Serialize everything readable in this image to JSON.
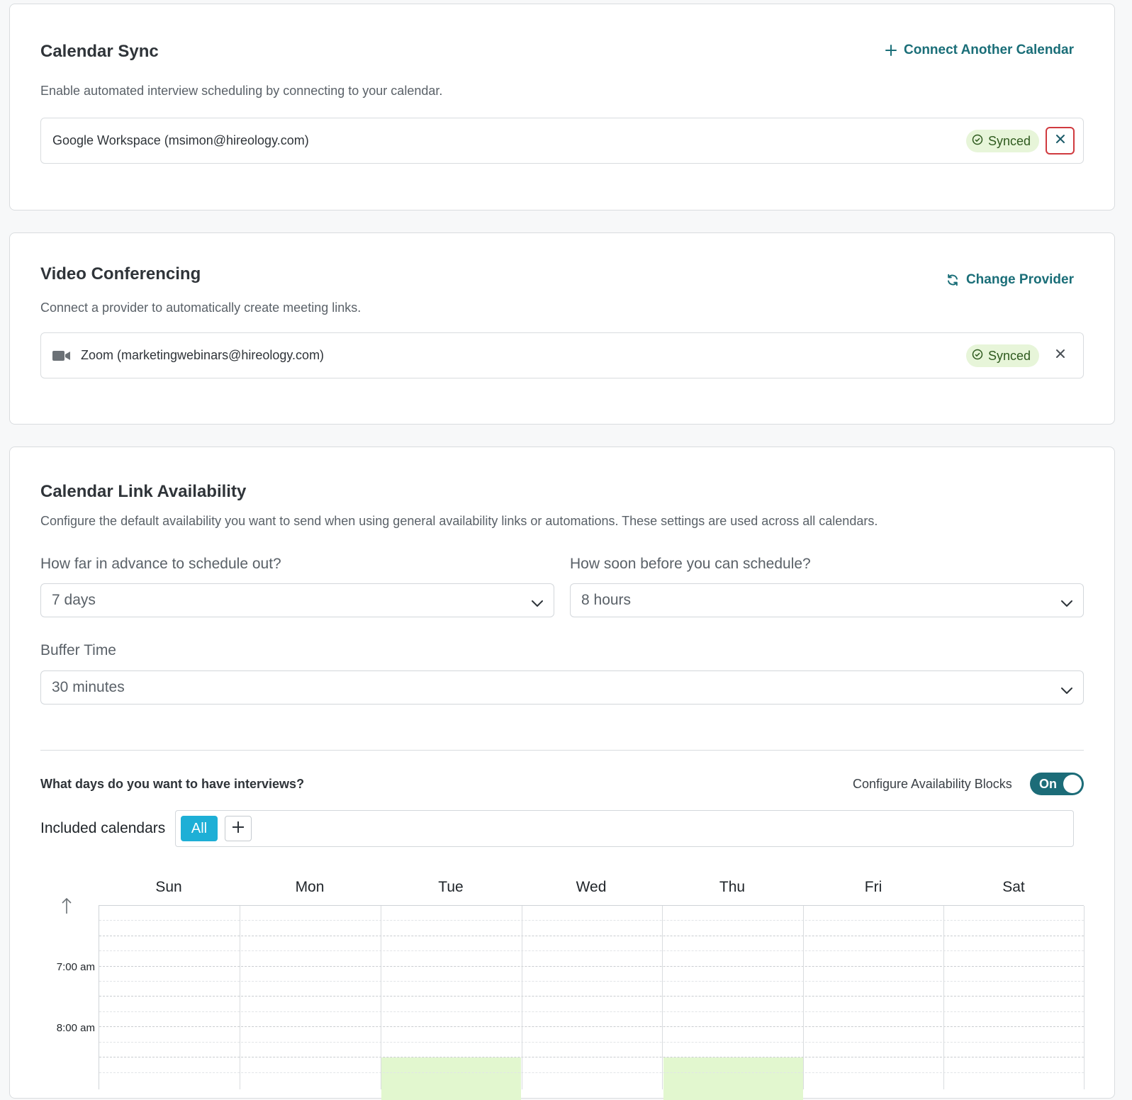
{
  "calendar_sync": {
    "title": "Calendar Sync",
    "action_label": "Connect Another Calendar",
    "action_icon": "plus-icon",
    "description": "Enable automated interview scheduling by connecting to your calendar.",
    "connection": {
      "name": "Google Workspace (msimon@hireology.com)",
      "status": "Synced",
      "remove_icon": "close-icon"
    }
  },
  "video_conferencing": {
    "title": "Video Conferencing",
    "action_label": "Change Provider",
    "action_icon": "refresh-icon",
    "description": "Connect a provider to automatically create meeting links.",
    "connection": {
      "icon": "video-camera-icon",
      "name": "Zoom (marketingwebinars@hireology.com)",
      "status": "Synced",
      "remove_icon": "close-icon"
    }
  },
  "availability": {
    "title": "Calendar Link Availability",
    "description": "Configure the default availability you want to send when using general availability links or automations. These settings are used across all calendars.",
    "advance": {
      "label": "How far in advance to schedule out?",
      "value": "7 days"
    },
    "soon": {
      "label": "How soon before you can schedule?",
      "value": "8 hours"
    },
    "buffer": {
      "label": "Buffer Time",
      "value": "30 minutes"
    },
    "days_question": "What days do you want to have interviews?",
    "configure_label": "Configure Availability Blocks",
    "toggle_label": "On",
    "included_label": "Included calendars",
    "all_label": "All",
    "days": [
      "Sun",
      "Mon",
      "Tue",
      "Wed",
      "Thu",
      "Fri",
      "Sat"
    ],
    "times": [
      "7:00 am",
      "8:00 am"
    ]
  },
  "colors": {
    "accent": "#1a6e78",
    "synced_bg": "#e7f5d9",
    "highlight": "#d03a3f",
    "all_button": "#1eafd6",
    "available_slot": "#e2f7cf"
  }
}
